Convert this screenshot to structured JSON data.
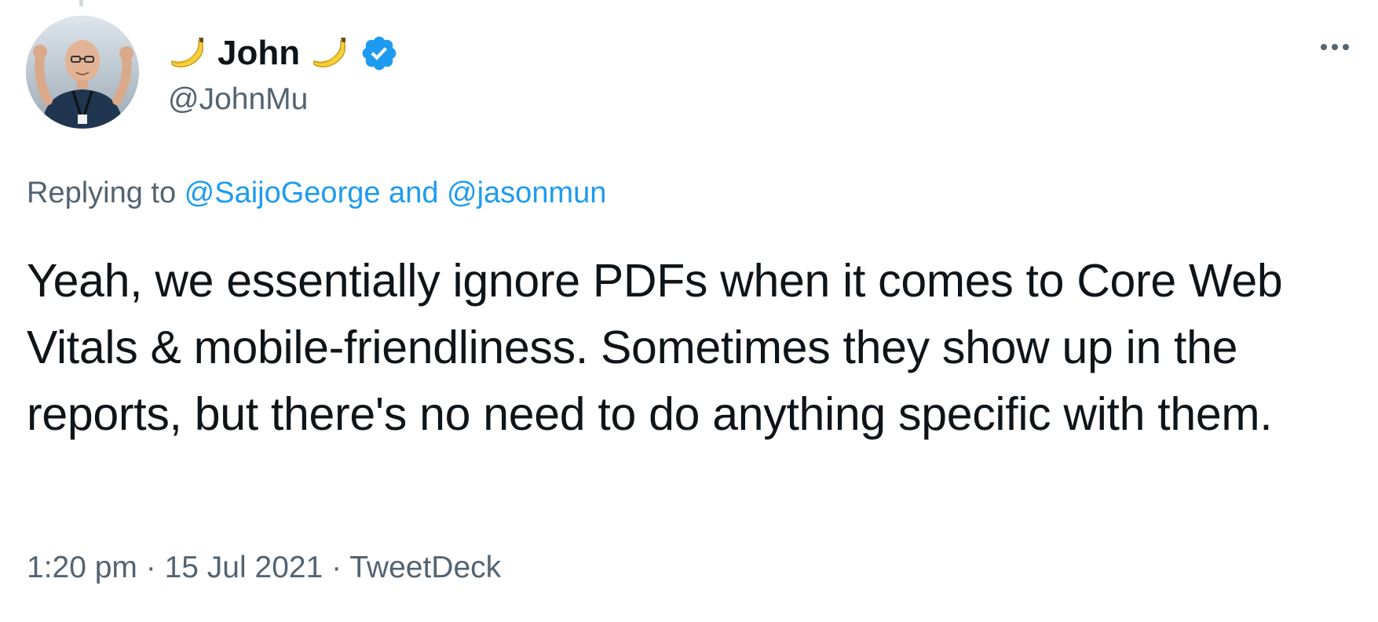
{
  "author": {
    "display_name": "John",
    "handle": "@JohnMu",
    "name_emoji": "banana-icon",
    "verified_icon": "verified-badge-icon"
  },
  "reply": {
    "prefix": "Replying to ",
    "mention_1": "@SaijoGeorge",
    "connector": " and ",
    "mention_2": "@jasonmun"
  },
  "tweet": {
    "text": "Yeah, we essentially ignore PDFs when it comes to Core Web Vitals & mobile-friendliness. Sometimes they show up in the reports, but there's no need to do anything specific with them."
  },
  "meta": {
    "time": "1:20 pm",
    "separator_1": " · ",
    "date": "15 Jul 2021",
    "separator_2": " · ",
    "source": "TweetDeck"
  },
  "colors": {
    "text_primary": "#0f1419",
    "text_secondary": "#536471",
    "link": "#1d9bf0",
    "verified": "#1d9bf0"
  },
  "icons": {
    "more": "more-horizontal-icon"
  }
}
